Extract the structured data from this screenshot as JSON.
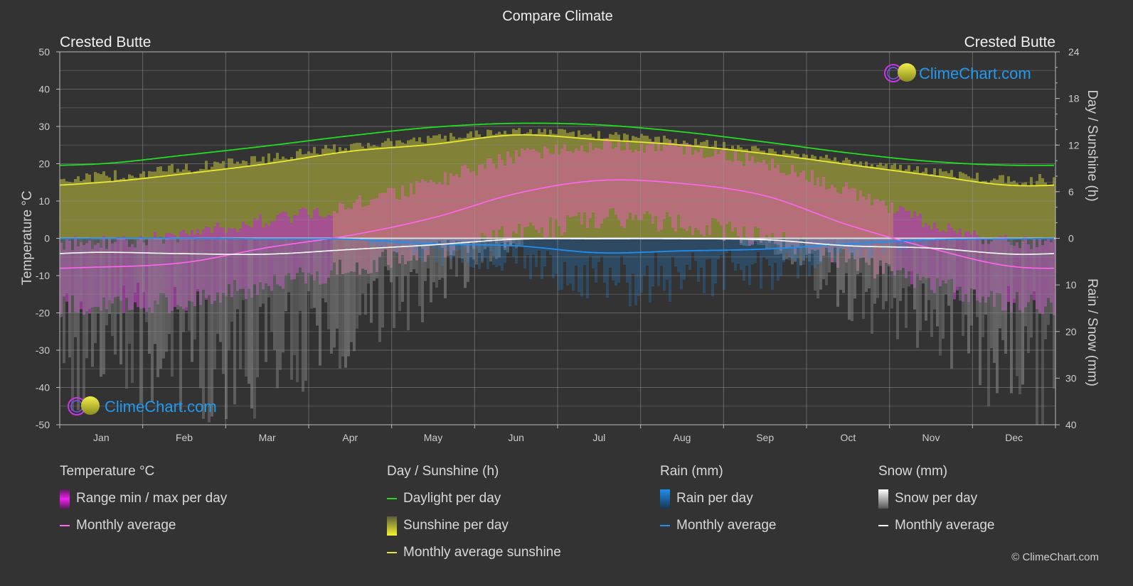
{
  "title": "Compare Climate",
  "location_left": "Crested Butte",
  "location_right": "Crested Butte",
  "watermark": "ClimeChart.com",
  "copyright": "© ClimeChart.com",
  "colors": {
    "background": "#333333",
    "daylight": "#22dd22",
    "sunshine_avg": "#e8e830",
    "sunshine_fill": "#8f8f38",
    "temp_avg": "#ff66ee",
    "temp_range_cold": "#b040b0",
    "temp_range_warm": "#c86a90",
    "rain": "#1e8ff0",
    "snow": "#ffffff",
    "brand": "#2299ee"
  },
  "legend": {
    "temperature": {
      "title": "Temperature °C",
      "items": [
        "Range min / max per day",
        "Monthly average"
      ]
    },
    "sunshine": {
      "title": "Day / Sunshine (h)",
      "items": [
        "Daylight per day",
        "Sunshine per day",
        "Monthly average sunshine"
      ]
    },
    "rain": {
      "title": "Rain (mm)",
      "items": [
        "Rain per day",
        "Monthly average"
      ]
    },
    "snow": {
      "title": "Snow (mm)",
      "items": [
        "Snow per day",
        "Monthly average"
      ]
    }
  },
  "chart_data": {
    "type": "line",
    "title": "Compare Climate",
    "categories": [
      "Jan",
      "Feb",
      "Mar",
      "Apr",
      "May",
      "Jun",
      "Jul",
      "Aug",
      "Sep",
      "Oct",
      "Nov",
      "Dec"
    ],
    "axes": {
      "left": {
        "label": "Temperature °C",
        "range": [
          -50,
          50
        ],
        "ticks": [
          50,
          40,
          30,
          20,
          10,
          0,
          -10,
          -20,
          -30,
          -40,
          -50
        ]
      },
      "right_top": {
        "label": "Day / Sunshine (h)",
        "range": [
          0,
          24
        ],
        "ticks": [
          24,
          18,
          12,
          6,
          0
        ]
      },
      "right_bottom": {
        "label": "Rain / Snow (mm)",
        "range": [
          0,
          40
        ],
        "ticks": [
          0,
          10,
          20,
          30,
          40
        ]
      }
    },
    "grid": true,
    "series": [
      {
        "name": "Daylight per day",
        "axis": "right_top",
        "unit": "h",
        "values": [
          9.6,
          10.7,
          11.9,
          13.2,
          14.3,
          14.8,
          14.6,
          13.7,
          12.4,
          11.0,
          9.9,
          9.4
        ]
      },
      {
        "name": "Monthly average sunshine",
        "axis": "right_top",
        "unit": "h",
        "values": [
          7.2,
          8.3,
          9.6,
          11.2,
          12.1,
          13.3,
          12.7,
          12.0,
          10.9,
          9.5,
          8.1,
          6.8
        ]
      },
      {
        "name": "Temperature monthly average",
        "axis": "left",
        "unit": "°C",
        "values": [
          -7.7,
          -6.5,
          -2.5,
          0.8,
          5.5,
          12.0,
          15.5,
          14.7,
          11.4,
          3.6,
          -2.7,
          -7.6
        ]
      },
      {
        "name": "Temperature range max (approx)",
        "axis": "left",
        "unit": "°C",
        "values": [
          -1,
          1,
          5,
          9,
          15,
          22,
          25,
          24,
          20,
          13,
          4,
          -1
        ]
      },
      {
        "name": "Temperature range min (approx)",
        "axis": "left",
        "unit": "°C",
        "values": [
          -18,
          -17,
          -12,
          -8,
          -3,
          1,
          5,
          4,
          0,
          -6,
          -12,
          -17
        ]
      },
      {
        "name": "Rain monthly average",
        "axis": "right_bottom",
        "unit": "mm",
        "values": [
          0.0,
          0.0,
          0.1,
          0.2,
          1.2,
          1.6,
          3.1,
          2.7,
          2.3,
          1.2,
          0.3,
          0.1
        ]
      },
      {
        "name": "Snow monthly average",
        "axis": "right_bottom",
        "unit": "mm",
        "values": [
          3.0,
          3.3,
          3.4,
          2.4,
          1.4,
          0.2,
          0.1,
          0.1,
          0.3,
          1.6,
          2.1,
          3.4
        ]
      }
    ],
    "legend_position": "bottom"
  }
}
